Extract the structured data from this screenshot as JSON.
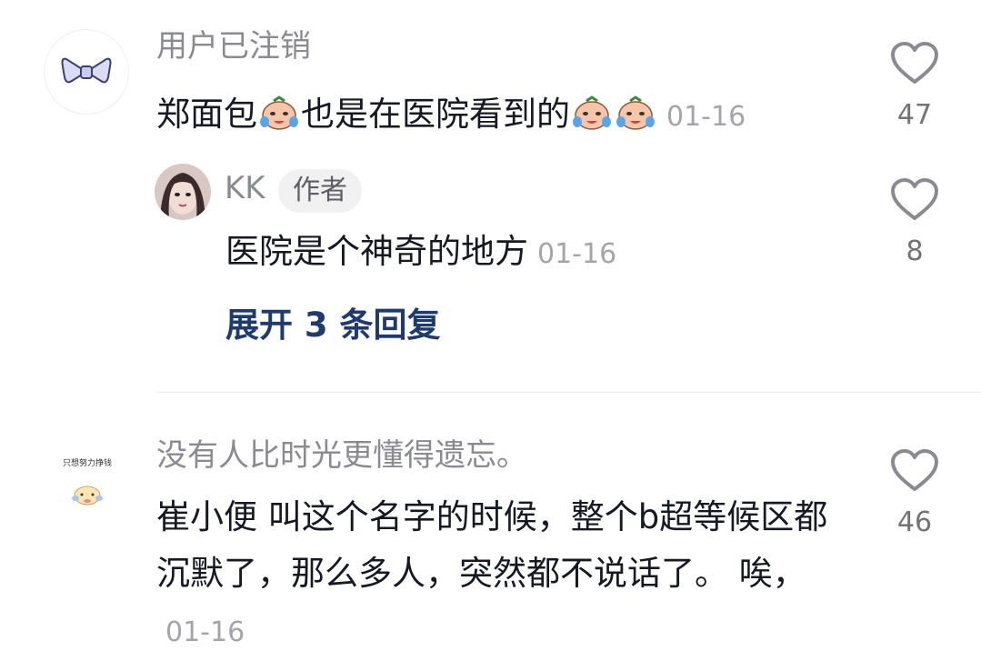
{
  "comments": [
    {
      "username": "用户已注销",
      "text_before": "郑面包",
      "text_after": "也是在医院看到的",
      "emoji": "crying-face-emoji",
      "time": "01-16",
      "likes": "47"
    },
    {
      "username": "KK",
      "badge": "作者",
      "text": "医院是个神奇的地方",
      "time": "01-16",
      "likes": "8"
    },
    {
      "expand_replies": "展开 3 条回复"
    },
    {
      "username": "没有人比时光更懂得遗忘。",
      "avatar_text": "只想努力挣钱",
      "text": "崔小便  叫这个名字的时候，整个b超等候区都沉默了，那么多人，突然都不说话了。 唉，",
      "time": "01-16",
      "likes": "46"
    }
  ],
  "icons": [
    "heart-outline-icon",
    "bow-icon"
  ]
}
